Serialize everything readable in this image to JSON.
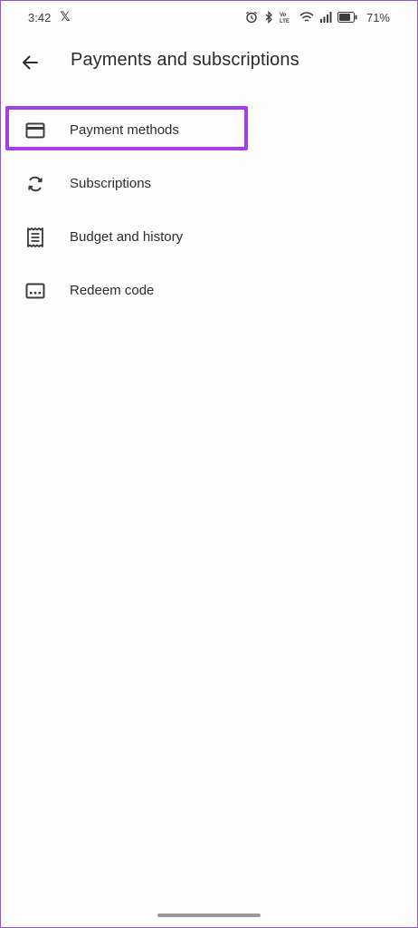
{
  "status_bar": {
    "time": "3:42",
    "notification_icon": "x-logo",
    "battery_percent": "71%",
    "icons": [
      "alarm-icon",
      "bluetooth-icon",
      "volte-icon",
      "wifi-icon",
      "signal-icon",
      "battery-icon"
    ],
    "x_glyph": "𝕏"
  },
  "app_bar": {
    "title": "Payments and subscriptions",
    "back_icon": "arrow-back-icon"
  },
  "menu": {
    "items": [
      {
        "label": "Payment methods",
        "icon": "credit-card-icon",
        "highlighted": true
      },
      {
        "label": "Subscriptions",
        "icon": "sync-icon"
      },
      {
        "label": "Budget and history",
        "icon": "receipt-icon"
      },
      {
        "label": "Redeem code",
        "icon": "redeem-code-icon"
      }
    ]
  },
  "colors": {
    "highlight": "#a63ee6",
    "frame_border": "#8e57d6",
    "text": "#2e2e2e",
    "icon": "#3c3c3c"
  }
}
